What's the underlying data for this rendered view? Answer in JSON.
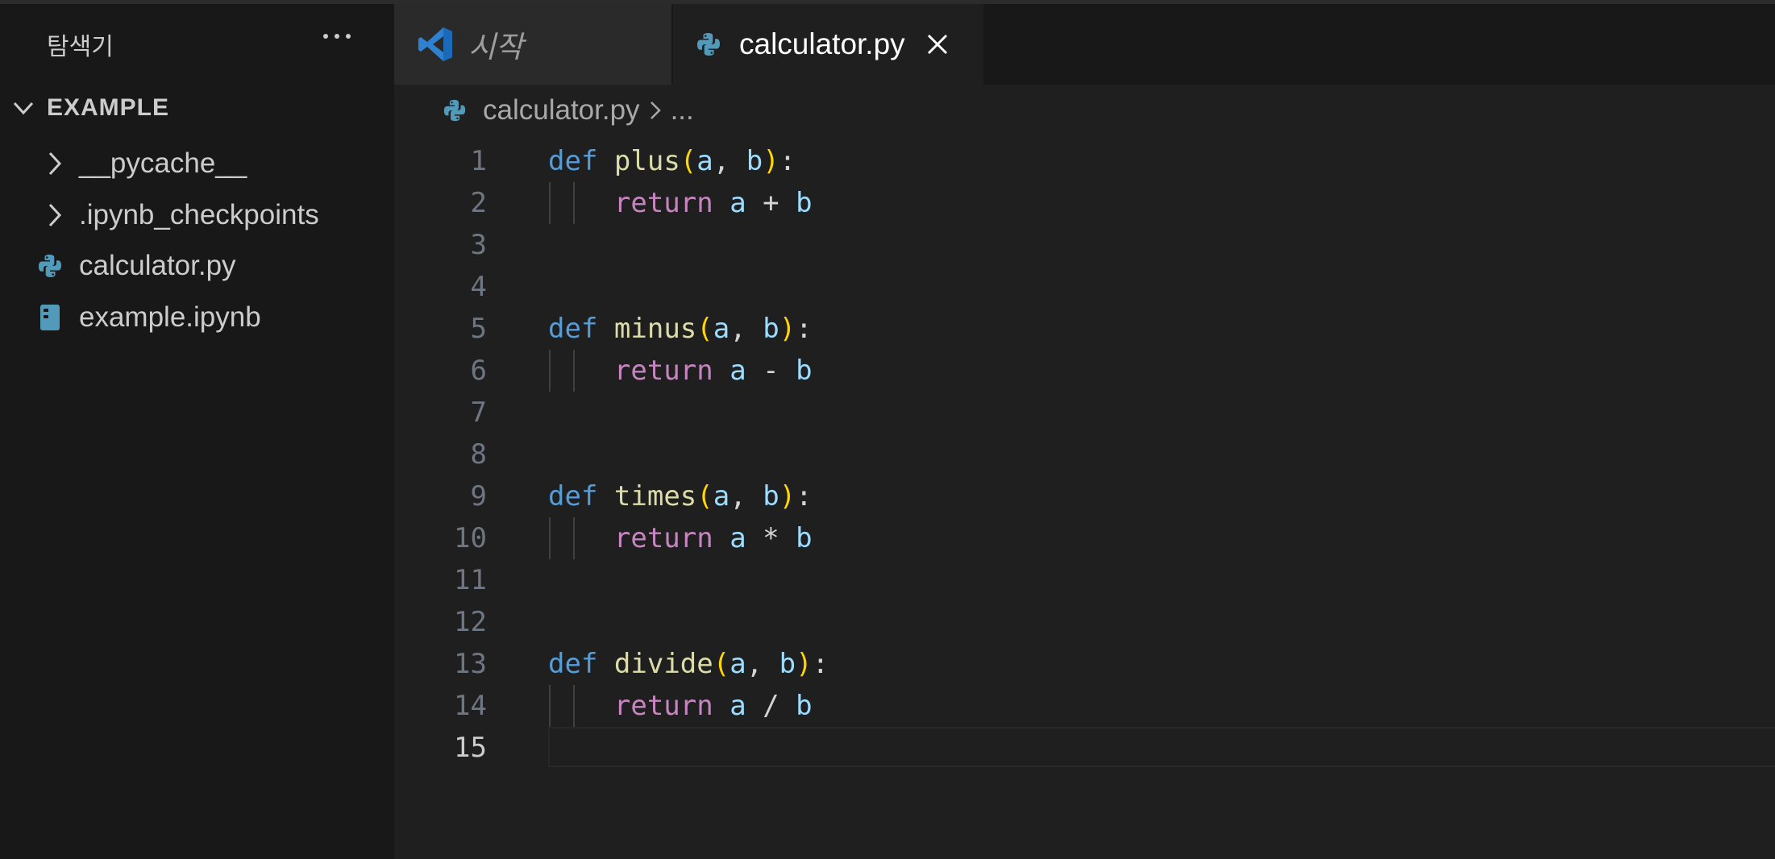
{
  "sidebar": {
    "title": "탐색기",
    "more_icon": "ellipsis-icon",
    "section": "EXAMPLE",
    "items": [
      {
        "label": "__pycache__",
        "type": "folder",
        "icon": "chevron-right-icon"
      },
      {
        "label": ".ipynb_checkpoints",
        "type": "folder",
        "icon": "chevron-right-icon"
      },
      {
        "label": "calculator.py",
        "type": "file",
        "icon": "python-icon"
      },
      {
        "label": "example.ipynb",
        "type": "file",
        "icon": "notebook-icon"
      }
    ]
  },
  "tabs": [
    {
      "label": "시작",
      "icon": "vscode-icon",
      "active": false
    },
    {
      "label": "calculator.py",
      "icon": "python-icon",
      "active": true
    }
  ],
  "breadcrumb": {
    "file": "calculator.py",
    "more": "..."
  },
  "editor": {
    "active_line": "15",
    "lines": [
      {
        "n": "1",
        "type": "def",
        "kw": "def",
        "name": "plus"
      },
      {
        "n": "2",
        "type": "ret",
        "kw": "return",
        "a": "a",
        "op": "+",
        "b": "b"
      },
      {
        "n": "3",
        "type": "empty"
      },
      {
        "n": "4",
        "type": "empty"
      },
      {
        "n": "5",
        "type": "def",
        "kw": "def",
        "name": "minus"
      },
      {
        "n": "6",
        "type": "ret",
        "kw": "return",
        "a": "a",
        "op": "-",
        "b": "b"
      },
      {
        "n": "7",
        "type": "empty"
      },
      {
        "n": "8",
        "type": "empty"
      },
      {
        "n": "9",
        "type": "def",
        "kw": "def",
        "name": "times"
      },
      {
        "n": "10",
        "type": "ret",
        "kw": "return",
        "a": "a",
        "op": "*",
        "b": "b"
      },
      {
        "n": "11",
        "type": "empty"
      },
      {
        "n": "12",
        "type": "empty"
      },
      {
        "n": "13",
        "type": "def",
        "kw": "def",
        "name": "divide"
      },
      {
        "n": "14",
        "type": "ret",
        "kw": "return",
        "a": "a",
        "op": "/",
        "b": "b"
      },
      {
        "n": "15",
        "type": "empty"
      }
    ]
  },
  "colors": {
    "python_blue": "#519aba",
    "vscode_blue": "#2f80d0",
    "keyword_def": "#569cd6",
    "function": "#dcdcaa",
    "param": "#9cdcfe",
    "keyword_return": "#c586c0",
    "bracket": "#ffd700"
  }
}
